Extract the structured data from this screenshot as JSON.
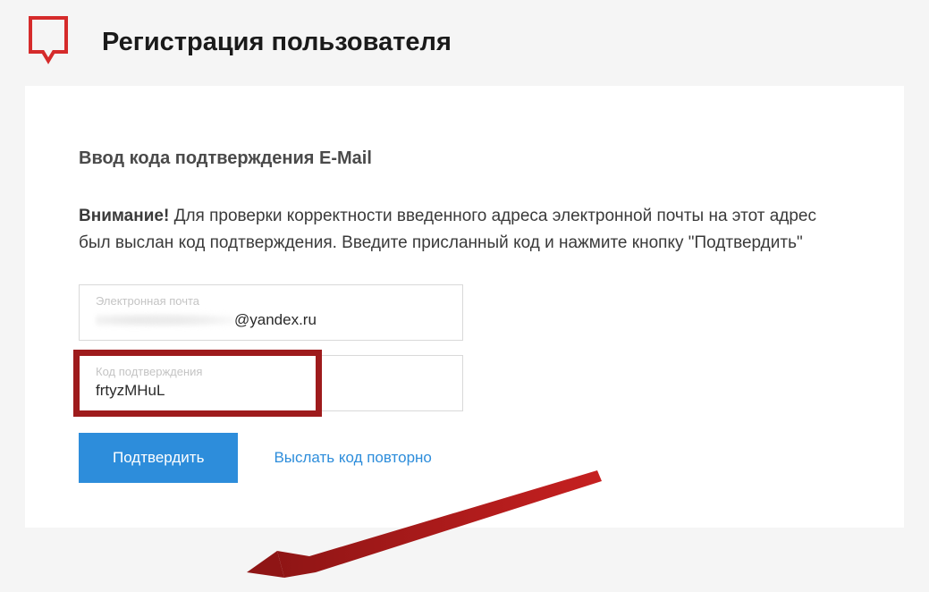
{
  "header": {
    "title": "Регистрация пользователя"
  },
  "content": {
    "subheading": "Ввод кода подтверждения E-Mail",
    "instruction_bold": "Внимание!",
    "instruction_rest": " Для проверки корректности введенного адреса электронной почты на этот адрес был выслан код подтверждения. Введите присланный код и нажмите кнопку \"Подтвердить\""
  },
  "email_field": {
    "label": "Электронная почта",
    "domain": "@yandex.ru"
  },
  "code_field": {
    "label": "Код подтверждения",
    "value": "frtyzMHuL"
  },
  "actions": {
    "confirm_label": "Подтвердить",
    "resend_label": "Выслать код повторно"
  }
}
